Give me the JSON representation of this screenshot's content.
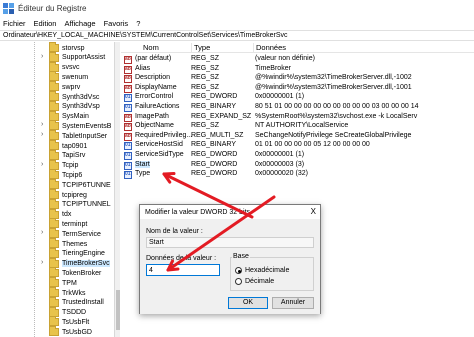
{
  "window": {
    "title": "Éditeur du Registre"
  },
  "menu": [
    "Fichier",
    "Edition",
    "Affichage",
    "Favoris",
    "?"
  ],
  "address": "Ordinateur\\HKEY_LOCAL_MACHINE\\SYSTEM\\CurrentControlSet\\Services\\TimeBrokerSvc",
  "tree": {
    "items": [
      {
        "label": "storvsp",
        "expandable": false
      },
      {
        "label": "SupportAssist",
        "expandable": true
      },
      {
        "label": "svsvc",
        "expandable": false
      },
      {
        "label": "swenum",
        "expandable": false
      },
      {
        "label": "swprv",
        "expandable": false
      },
      {
        "label": "Synth3dVsc",
        "expandable": false
      },
      {
        "label": "Synth3dVsp",
        "expandable": false
      },
      {
        "label": "SysMain",
        "expandable": false
      },
      {
        "label": "SystemEventsB",
        "expandable": true
      },
      {
        "label": "TabletInputSer",
        "expandable": true
      },
      {
        "label": "tap0901",
        "expandable": false
      },
      {
        "label": "TapiSrv",
        "expandable": false
      },
      {
        "label": "Tcpip",
        "expandable": true
      },
      {
        "label": "Tcpip6",
        "expandable": false
      },
      {
        "label": "TCPIP6TUNNE",
        "expandable": false
      },
      {
        "label": "tcpipreg",
        "expandable": false
      },
      {
        "label": "TCPIPTUNNEL",
        "expandable": false
      },
      {
        "label": "tdx",
        "expandable": false
      },
      {
        "label": "terminpt",
        "expandable": false
      },
      {
        "label": "TermService",
        "expandable": true
      },
      {
        "label": "Themes",
        "expandable": false
      },
      {
        "label": "TieringEngine",
        "expandable": false
      },
      {
        "label": "TimeBrokerSvc",
        "expandable": true,
        "selected": true
      },
      {
        "label": "TokenBroker",
        "expandable": false
      },
      {
        "label": "TPM",
        "expandable": false
      },
      {
        "label": "TrkWks",
        "expandable": false
      },
      {
        "label": "TrustedInstall",
        "expandable": false
      },
      {
        "label": "TSDDD",
        "expandable": false
      },
      {
        "label": "TsUsbFlt",
        "expandable": false
      },
      {
        "label": "TsUsbGD",
        "expandable": false
      }
    ]
  },
  "columns": {
    "name": "Nom",
    "type": "Type",
    "data": "Données"
  },
  "values": [
    {
      "name": "(par défaut)",
      "type": "REG_SZ",
      "data": "(valeur non définie)",
      "kind": "sz"
    },
    {
      "name": "Alias",
      "type": "REG_SZ",
      "data": "TimeBroker",
      "kind": "sz"
    },
    {
      "name": "Description",
      "type": "REG_SZ",
      "data": "@%windir%\\system32\\TimeBrokerServer.dll,-1002",
      "kind": "sz"
    },
    {
      "name": "DisplayName",
      "type": "REG_SZ",
      "data": "@%windir%\\system32\\TimeBrokerServer.dll,-1001",
      "kind": "sz"
    },
    {
      "name": "ErrorControl",
      "type": "REG_DWORD",
      "data": "0x00000001 (1)",
      "kind": "bin"
    },
    {
      "name": "FailureActions",
      "type": "REG_BINARY",
      "data": "80 51 01 00 00 00 00 00 00 00 00 00 03 00 00 00 14",
      "kind": "bin"
    },
    {
      "name": "ImagePath",
      "type": "REG_EXPAND_SZ",
      "data": "%SystemRoot%\\system32\\svchost.exe -k LocalServ",
      "kind": "sz"
    },
    {
      "name": "ObjectName",
      "type": "REG_SZ",
      "data": "NT AUTHORITY\\LocalService",
      "kind": "sz"
    },
    {
      "name": "RequiredPrivileg...",
      "type": "REG_MULTI_SZ",
      "data": "SeChangeNotifyPrivilege SeCreateGlobalPrivilege",
      "kind": "sz"
    },
    {
      "name": "ServiceHostSid",
      "type": "REG_BINARY",
      "data": "01 01 00 00 00 00 05 12 00 00 00 00",
      "kind": "bin"
    },
    {
      "name": "ServiceSidType",
      "type": "REG_DWORD",
      "data": "0x00000001 (1)",
      "kind": "bin"
    },
    {
      "name": "Start",
      "type": "REG_DWORD",
      "data": "0x00000003 (3)",
      "kind": "bin",
      "highlight": true
    },
    {
      "name": "Type",
      "type": "REG_DWORD",
      "data": "0x00000020 (32)",
      "kind": "bin"
    }
  ],
  "dialog": {
    "title": "Modifier la valeur DWORD 32 bits",
    "close": "X",
    "name_label": "Nom de la valeur :",
    "name_value": "Start",
    "data_label": "Données de la valeur :",
    "data_value": "4",
    "base_label": "Base",
    "hex_label": "Hexadécimale",
    "dec_label": "Décimale",
    "ok": "OK",
    "cancel": "Annuler"
  },
  "colors": {
    "annotation": "#e31b23",
    "selection": "#cce8ff",
    "accent": "#0078d7"
  }
}
